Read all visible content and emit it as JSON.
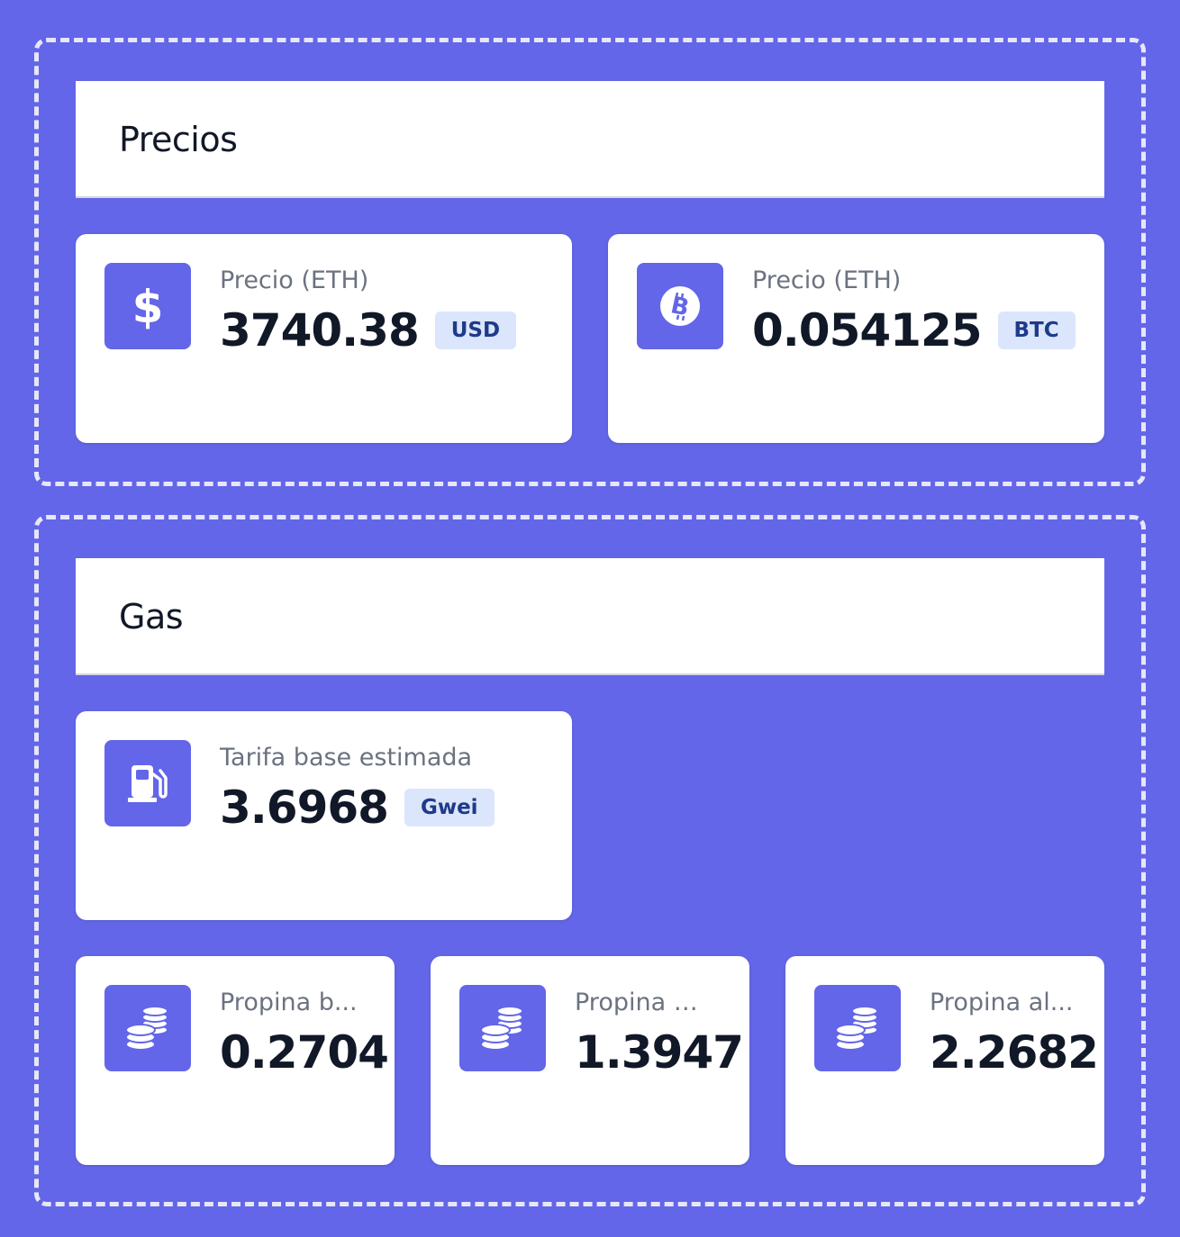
{
  "colors": {
    "accent": "#6366e8",
    "badge_bg": "#dbe5fb",
    "badge_text": "#1e3a8a"
  },
  "prices": {
    "title": "Precios",
    "cards": [
      {
        "icon": "dollar-icon",
        "label": "Precio (ETH)",
        "value": "3740.38",
        "unit": "USD"
      },
      {
        "icon": "bitcoin-icon",
        "label": "Precio (ETH)",
        "value": "0.054125",
        "unit": "BTC"
      }
    ]
  },
  "gas": {
    "title": "Gas",
    "base_fee": {
      "icon": "gas-pump-icon",
      "label": "Tarifa base estimada",
      "value": "3.6968",
      "unit": "Gwei"
    },
    "tips": [
      {
        "icon": "coins-icon",
        "label": "Propina b...",
        "value": "0.2704"
      },
      {
        "icon": "coins-icon",
        "label": "Propina m...",
        "value": "1.3947"
      },
      {
        "icon": "coins-icon",
        "label": "Propina al...",
        "value": "2.2682"
      }
    ]
  }
}
